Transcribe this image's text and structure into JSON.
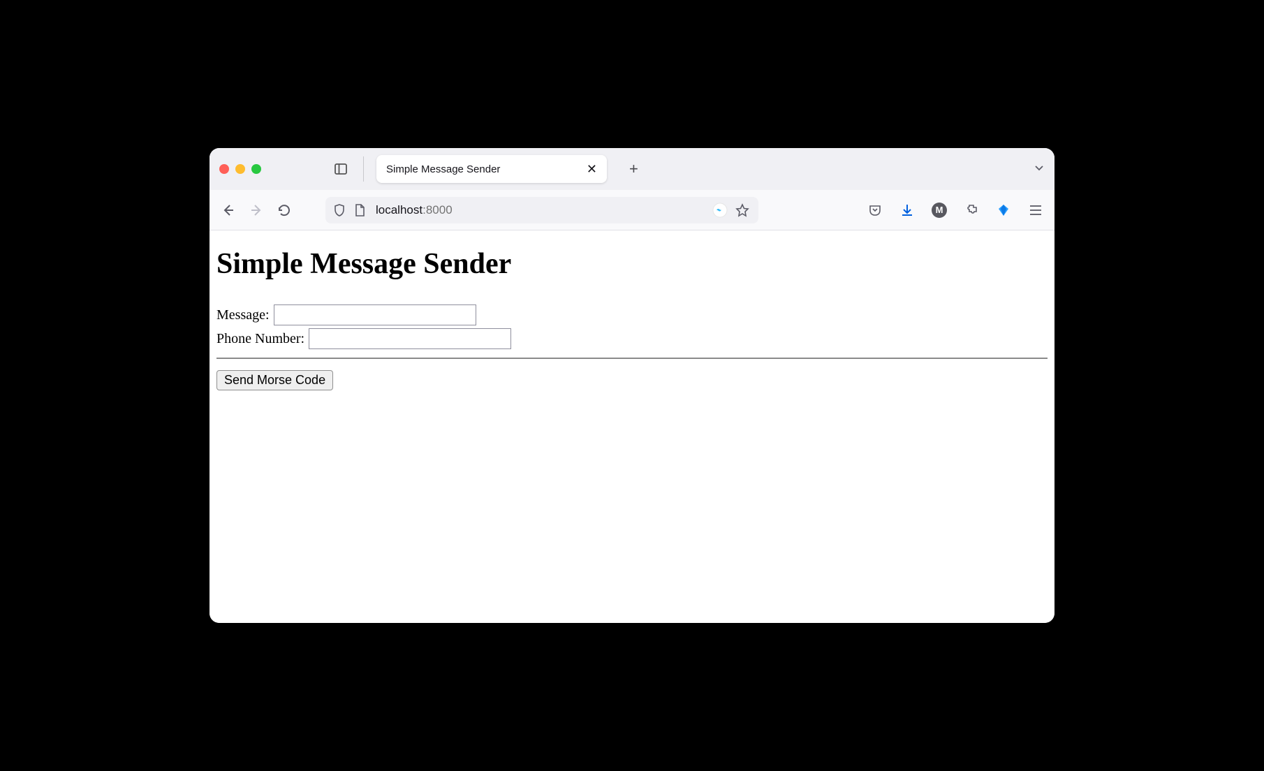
{
  "browser": {
    "tab_title": "Simple Message Sender",
    "url_host": "localhost",
    "url_port": ":8000"
  },
  "page": {
    "heading": "Simple Message Sender",
    "message_label": "Message:",
    "phone_label": "Phone Number:",
    "submit_label": "Send Morse Code"
  }
}
